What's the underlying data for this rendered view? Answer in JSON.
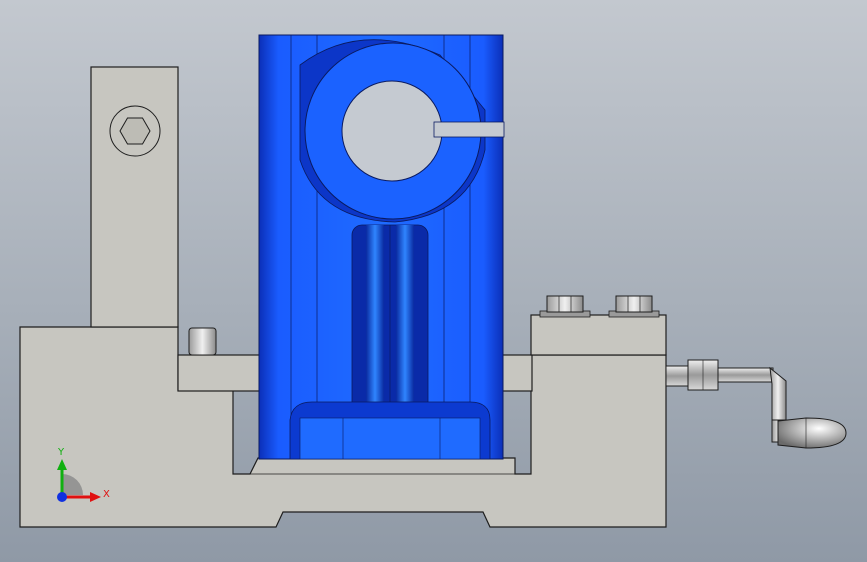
{
  "colors": {
    "background_top": "#c3c8cf",
    "background_bottom": "#8f99a6",
    "body_gray": "#c7c6c0",
    "body_edge": "#1e1e1e",
    "clamp_blue": "#1560ff",
    "clamp_blue_light": "#2f7bff",
    "clamp_blue_dark": "#0a2aa8",
    "axis_x": "#e01010",
    "axis_y": "#10b010",
    "axis_z": "#1030e0"
  },
  "triad": {
    "x_label": "X",
    "y_label": "Y"
  },
  "icons": {
    "hex_socket": "hexagon-socket-icon",
    "triad": "xyz-triad-icon"
  }
}
